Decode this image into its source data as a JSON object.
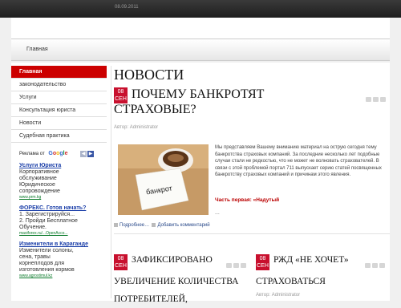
{
  "topbar": {
    "date": "08.09.2011"
  },
  "nav": {
    "home": "Главная"
  },
  "sidebar": {
    "items": [
      {
        "label": "Главная"
      },
      {
        "label": "законодательство"
      },
      {
        "label": "Услуги"
      },
      {
        "label": "Консультация юриста"
      },
      {
        "label": "Новости"
      },
      {
        "label": "Судебная практика"
      }
    ]
  },
  "ads": {
    "header": "Реклама от",
    "logo": "Google",
    "items": [
      {
        "title": "Услуги Юриста",
        "lines": [
          "Корпоративное",
          "обслуживание",
          "Юридическое",
          "сопровождение"
        ],
        "url": "www.prm.kg"
      },
      {
        "title": "ФОРЕКС. Готов начать?",
        "lines": [
          "1. Зарегистрируйся...",
          "2. Пройди Бесплатное",
          "Обучение."
        ],
        "url": "maxiforex.ru/...OpenAcco..."
      },
      {
        "title": "Изменители в Караганде",
        "lines": [
          "Изменители солоны,",
          "сена, травы",
          "корнеплодов для",
          "изготовления кормов"
        ],
        "url": "www.agrostimul.kz"
      }
    ]
  },
  "main": {
    "section_title": "НОВОСТИ",
    "lead": {
      "day": "08",
      "month": "СЕН",
      "title_line1": "ПОЧЕМУ БАНКРОТЯТ",
      "title_line2": "СТРАХОВЫЕ?",
      "author": "Автор: Administrator",
      "image_caption": "банкрот",
      "body": "Мы представляем Вашему вниманию материал на острую сегодня тему банкротства страховых компаний. За последние несколько лет подобные случаи стали не редкостью, что не может не волновать страхователей. В связи с этой проблемой портал 711 выпускает серию статей посвященных банкротству страховых компаний и причинам этого явления.",
      "series": "Часть первая: «Надутый",
      "ellipsis": "...",
      "more": "Подробнее…",
      "comment": "Добавить комментарий"
    },
    "card1": {
      "day": "08",
      "month": "СЕН",
      "title": [
        "ЗАФИКСИРОВАНО",
        "УВЕЛИЧЕНИЕ КОЛИЧЕСТВА",
        "ПОТРЕБИТЕЛЕЙ,"
      ]
    },
    "card2": {
      "day": "08",
      "month": "СЕН",
      "title": [
        "РЖД «НЕ ХОЧЕТ»",
        "СТРАХОВАТЬСЯ"
      ],
      "author": "Автор: Administrator"
    }
  }
}
